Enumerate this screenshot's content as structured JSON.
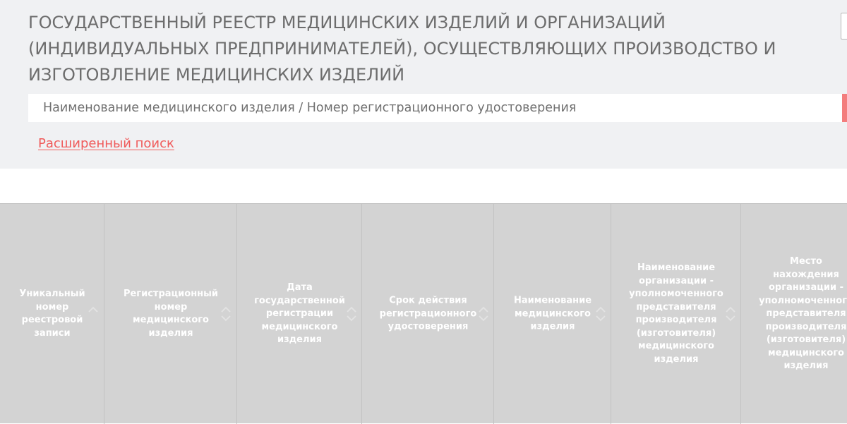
{
  "header": {
    "title": "Государственный реестр медицинских изделий и организаций (индивидуальных предпринимателей), осуществляющих производство и изготовление медицинских изделий"
  },
  "search": {
    "placeholder": "Наименование медицинского изделия / Номер регистрационного удостоверения",
    "value": ""
  },
  "advanced_search": {
    "label": "Расширенный поиск"
  },
  "colors": {
    "header_bg": "#f0f1f3",
    "accent": "#f05a5a",
    "table_header_bg": "#d3d3d3",
    "title_text": "#6d6d6d"
  },
  "table": {
    "columns": [
      {
        "label": "Уникальный\nномер\nреестровой\nзаписи",
        "sort_icon": "sort-icon"
      },
      {
        "label": "Регистрационный\nномер\nмедицинского\nизделия",
        "sort_icon": "sort-icon"
      },
      {
        "label": "Дата\nгосударственной\nрегистрации\nмедицинского\nизделия",
        "sort_icon": "sort-icon"
      },
      {
        "label": "Срок действия\nрегистрационного\nудостоверения",
        "sort_icon": "sort-icon"
      },
      {
        "label": "Наименование\nмедицинского\nизделия",
        "sort_icon": "sort-icon"
      },
      {
        "label": "Наименование\nорганизации -\nуполномоченного\nпредставителя\nпроизводителя\n(изготовителя)\nмедицинского\nизделия",
        "sort_icon": "sort-icon"
      },
      {
        "label": "Место\nнахождения\nорганизации -\nуполномоченного\nпредставителя\nпроизводителя\n(изготовителя)\nмедицинского\nизделия",
        "sort_icon": "sort-icon"
      }
    ]
  }
}
